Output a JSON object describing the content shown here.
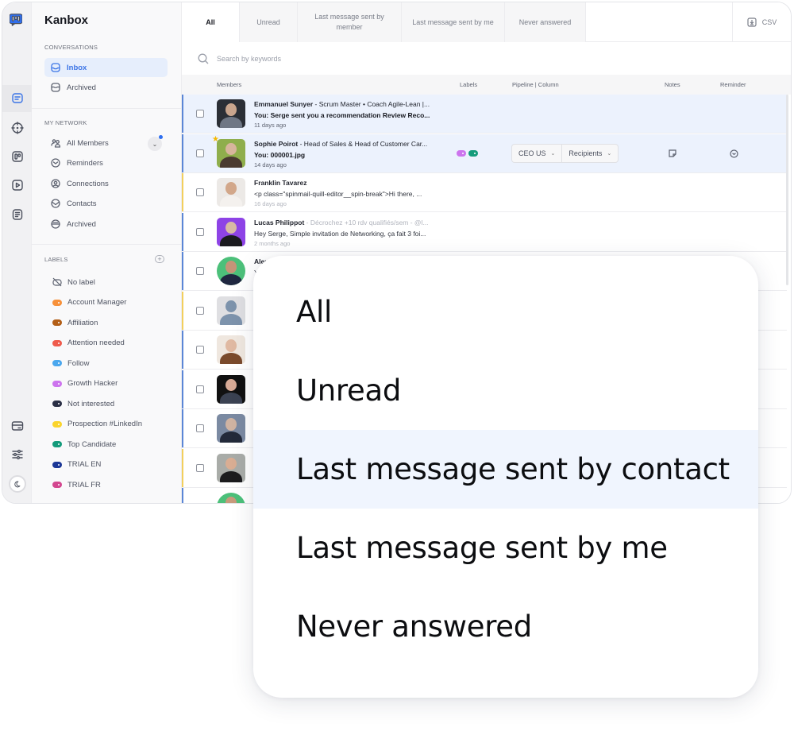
{
  "app": {
    "brand": "Kanbox",
    "accent_color": "#3b74e6"
  },
  "rail": {
    "icons": [
      "kanbox-logo-icon",
      "inbox-chat-icon",
      "target-icon",
      "pipeline-icon",
      "video-icon",
      "document-icon",
      "billing-card-icon",
      "settings-sliders-icon",
      "dark-mode-icon"
    ]
  },
  "sidebar": {
    "conversations_title": "CONVERSATIONS",
    "conversations": [
      {
        "label": "Inbox",
        "icon": "inbox-icon",
        "active": true
      },
      {
        "label": "Archived",
        "icon": "archive-icon",
        "active": false
      }
    ],
    "network_title": "MY NETWORK",
    "network": [
      {
        "label": "All Members",
        "icon": "members-icon"
      },
      {
        "label": "Reminders",
        "icon": "clock-icon"
      },
      {
        "label": "Connections",
        "icon": "user-circle-icon"
      },
      {
        "label": "Contacts",
        "icon": "envelope-circle-icon"
      },
      {
        "label": "Archived",
        "icon": "archive-circle-icon"
      }
    ],
    "labels_title": "LABELS",
    "labels": [
      {
        "label": "No label",
        "color": null
      },
      {
        "label": "Account Manager",
        "color": "#f7913a"
      },
      {
        "label": "Affiliation",
        "color": "#b25e16"
      },
      {
        "label": "Attention needed",
        "color": "#ef5b4c"
      },
      {
        "label": "Follow",
        "color": "#4aa7ee"
      },
      {
        "label": "Growth Hacker",
        "color": "#cd74ee"
      },
      {
        "label": "Not interested",
        "color": "#2a2f45"
      },
      {
        "label": "Prospection #LinkedIn",
        "color": "#fad42c"
      },
      {
        "label": "Top Candidate",
        "color": "#149b7b"
      },
      {
        "label": "TRIAL EN",
        "color": "#1c3796"
      },
      {
        "label": "TRIAL FR",
        "color": "#d3478f"
      }
    ]
  },
  "tabs": [
    {
      "label": "All",
      "active": true
    },
    {
      "label": "Unread",
      "active": false
    },
    {
      "label": "Last message sent by member",
      "active": false
    },
    {
      "label": "Last message sent by me",
      "active": false
    },
    {
      "label": "Never answered",
      "active": false
    }
  ],
  "csv_label": "CSV",
  "search": {
    "placeholder": "Search by keywords",
    "value": ""
  },
  "table": {
    "columns": {
      "members": "Members",
      "labels": "Labels",
      "pipeline": "Pipeline | Column",
      "notes": "Notes",
      "reminder": "Reminder"
    },
    "rows": [
      {
        "name": "Emmanuel Sunyer",
        "headline": " - Scrum Master • Coach Agile-Lean |...",
        "message": "You: Serge sent you a recommendation Review Reco...",
        "time": "11 days ago",
        "unread": true,
        "highlight": true,
        "bar": "#5b86d6",
        "avatar_bg": "#2b2f36",
        "avatar_skin": "#c9a58d",
        "avatar_body": "#6f7785"
      },
      {
        "name": "Sophie Poirot",
        "headline": " - Head of Sales & Head of Customer Car...",
        "message": "You: 000001.jpg",
        "time": "14 days ago",
        "unread": true,
        "highlight": true,
        "starred": true,
        "labels": [
          "#cd74ee",
          "#149b7b"
        ],
        "pipeline": "CEO US",
        "column": "Recipients",
        "bar": "#5b86d6",
        "avatar_bg": "#8fae4c",
        "avatar_skin": "#d7b59c",
        "avatar_body": "#4a3a30"
      },
      {
        "name": "Franklin Tavarez",
        "headline": "",
        "message": "<p class=\"spinmail-quill-editor__spin-break\">Hi there, ...",
        "time": "16 days ago",
        "unread": false,
        "bar": "#f2cf5c",
        "avatar_bg": "#ece9e6",
        "avatar_skin": "#d2a78a",
        "avatar_body": "#f4f1ee"
      },
      {
        "name": "Lucas Philippot",
        "headline": " - Décrochez +10 rdv qualifiés/sem - @l...",
        "message": "Hey Serge, Simple invitation de Networking, ça fait 3 foi...",
        "time": "2 months ago",
        "unread": false,
        "bar": "#5b86d6",
        "avatar_bg": "#8e43e6",
        "avatar_skin": "#d8b9a4",
        "avatar_body": "#1b1b1f"
      },
      {
        "name": "Alexa",
        "headline": "",
        "message": "Yo",
        "time": "",
        "unread": false,
        "bar": "#5b86d6",
        "round": true,
        "avatar_bg": "#4cc07a",
        "avatar_skin": "#c49478",
        "avatar_body": "#1f2740"
      },
      {
        "name": "",
        "message": "",
        "time": "",
        "bar": "#f2cf5c",
        "avatar_bg": "#dfdfe2",
        "avatar_skin": "#7d93ac",
        "avatar_body": "#7d93ac"
      },
      {
        "name": "",
        "message": "",
        "time": "",
        "bar": "#5b86d6",
        "avatar_bg": "#efe7df",
        "avatar_skin": "#e0b9a2",
        "avatar_body": "#7a4a2c"
      },
      {
        "name": "",
        "message": "",
        "time": "",
        "bar": "#5b86d6",
        "avatar_bg": "#111111",
        "avatar_skin": "#d8aa96",
        "avatar_body": "#3b4252"
      },
      {
        "name": "",
        "message": "",
        "time": "",
        "bar": "#5b86d6",
        "round": false,
        "avatar_bg": "#7b8aa2",
        "avatar_skin": "#cfb3a2",
        "avatar_body": "#232a3a"
      },
      {
        "name": "",
        "message": "",
        "time": "",
        "bar": "#f2cf5c",
        "avatar_bg": "#a9aca8",
        "avatar_skin": "#d9ad93",
        "avatar_body": "#1c1c1e"
      },
      {
        "name": "",
        "message": "",
        "time": "",
        "bar": "#5b86d6",
        "round": true,
        "avatar_bg": "#4cc07a",
        "avatar_skin": "#c89a7c",
        "avatar_body": "#222"
      }
    ]
  },
  "dropdown": {
    "options": [
      {
        "label": "All",
        "hovered": false
      },
      {
        "label": "Unread",
        "hovered": false
      },
      {
        "label": "Last message sent by contact",
        "hovered": true
      },
      {
        "label": "Last message sent by me",
        "hovered": false
      },
      {
        "label": "Never answered",
        "hovered": false
      }
    ]
  }
}
